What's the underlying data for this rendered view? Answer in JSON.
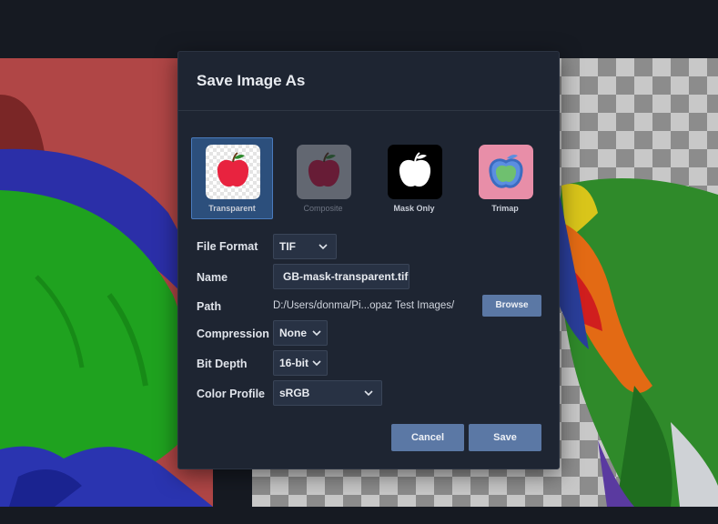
{
  "dialog": {
    "title": "Save Image As"
  },
  "options": [
    {
      "label": "Transparent",
      "icon": "apple-icon",
      "selected": true
    },
    {
      "label": "Composite",
      "icon": "apple-icon",
      "selected": false
    },
    {
      "label": "Mask Only",
      "icon": "apple-icon",
      "selected": false
    },
    {
      "label": "Trimap",
      "icon": "apple-icon",
      "selected": false
    }
  ],
  "form": {
    "file_format_label": "File Format",
    "file_format_value": "TIF",
    "name_label": "Name",
    "name_value": "GB-mask-transparent.tif",
    "path_label": "Path",
    "path_value": "D:/Users/donma/Pi...opaz Test Images/",
    "browse_label": "Browse",
    "compression_label": "Compression",
    "compression_value": "None",
    "bit_depth_label": "Bit Depth",
    "bit_depth_value": "16-bit",
    "color_profile_label": "Color Profile",
    "color_profile_value": "sRGB"
  },
  "buttons": {
    "cancel_label": "Cancel",
    "save_label": "Save"
  },
  "colors": {
    "dialog_bg": "#1e2532",
    "selected_option": "#2c4f7c",
    "button": "#5b78a5",
    "apple_red": "#e8233f"
  }
}
